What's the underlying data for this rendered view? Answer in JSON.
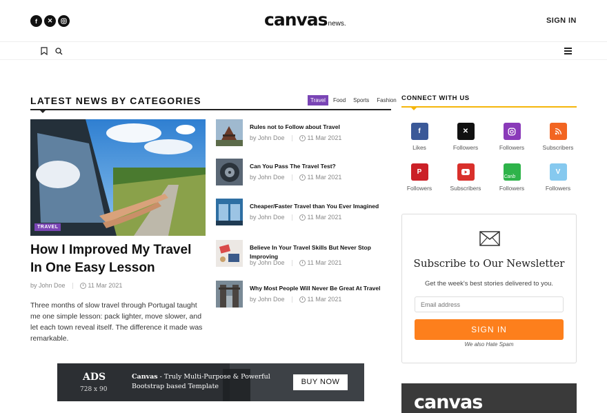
{
  "header": {
    "social_icons": [
      "facebook-icon",
      "x-icon",
      "instagram-icon"
    ],
    "logo_main": "canvas",
    "logo_sub": "news.",
    "sign_in": "SIGN IN"
  },
  "subnav": {
    "icons": [
      "bookmark-icon",
      "search-icon",
      "menu-icon"
    ]
  },
  "section": {
    "title": "LATEST NEWS BY CATEGORIES",
    "tabs": [
      {
        "label": "Travel",
        "active": true
      },
      {
        "label": "Food",
        "active": false
      },
      {
        "label": "Sports",
        "active": false
      },
      {
        "label": "Fashion",
        "active": false
      }
    ]
  },
  "featured": {
    "badge": "TRAVEL",
    "title": "How I Improved My Travel In One Easy Lesson",
    "author": "by John Doe",
    "date": "11 Mar 2021",
    "excerpt": "Three months of slow travel through Portugal taught me one simple lesson: pack lighter, move slower, and let each town reveal itself. The difference it made was remarkable."
  },
  "articles": [
    {
      "title": "Rules not to Follow about Travel",
      "author": "by John Doe",
      "date": "11 Mar 2021"
    },
    {
      "title": "Can You Pass The Travel Test?",
      "author": "by John Doe",
      "date": "11 Mar 2021"
    },
    {
      "title": "Cheaper/Faster Travel than You Ever Imagined",
      "author": "by John Doe",
      "date": "11 Mar 2021"
    },
    {
      "title": "Believe In Your Travel Skills But Never Stop Improving",
      "author": "by John Doe",
      "date": "11 Mar 2021"
    },
    {
      "title": "Why Most People Will Never Be Great At Travel",
      "author": "by John Doe",
      "date": "11 Mar 2021"
    }
  ],
  "connect": {
    "title": "CONNECT WITH US",
    "items": [
      {
        "network": "facebook",
        "label": "Likes",
        "color": "#3b5998",
        "glyph": "f"
      },
      {
        "network": "x",
        "label": "Followers",
        "color": "#111111",
        "glyph": "𝕏"
      },
      {
        "network": "instagram",
        "label": "Followers",
        "color": "#8a3ab9",
        "glyph": "◎"
      },
      {
        "network": "rss",
        "label": "Subscribers",
        "color": "#f26522",
        "glyph": "◔"
      },
      {
        "network": "pinterest",
        "label": "Followers",
        "color": "#cb2027",
        "glyph": "P"
      },
      {
        "network": "youtube",
        "label": "Subscribers",
        "color": "#d9302b",
        "glyph": "▶"
      },
      {
        "network": "caribbean",
        "label": "Followers",
        "color": "#2eb34a",
        "glyph": "Carib"
      },
      {
        "network": "vimeo",
        "label": "Followers",
        "color": "#86c9ef",
        "glyph": "V"
      }
    ]
  },
  "newsletter": {
    "title": "Subscribe to Our Newsletter",
    "subtitle": "Get the week's best stories delivered to you.",
    "email_placeholder": "Email address",
    "button": "SIGN IN",
    "note": "We also Hate Spam"
  },
  "ad": {
    "label": "ADS",
    "size": "728 x 90",
    "brand": "Canvas",
    "text": " - Truly Multi-Purpose & Powerful Bootstrap based Template",
    "button": "BUY NOW"
  },
  "promo": {
    "text": "canvas"
  },
  "colors": {
    "accent_purple": "#7a45b5",
    "accent_yellow": "#f5b50a",
    "accent_orange": "#fd7f1c"
  }
}
